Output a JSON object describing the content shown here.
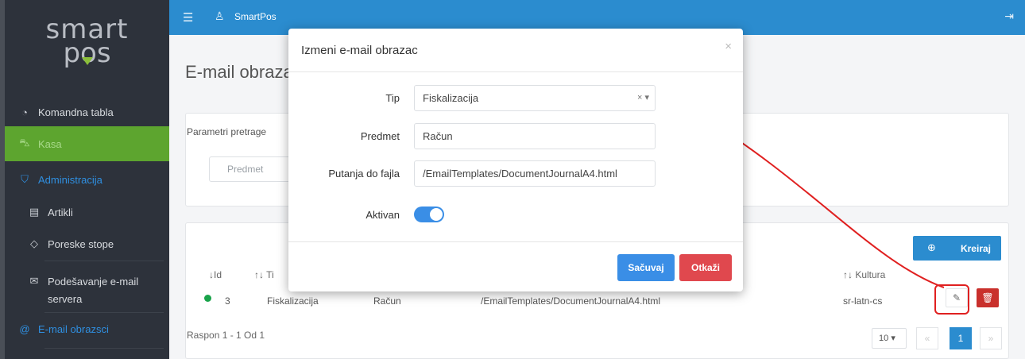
{
  "sidebar": {
    "logo_line1": "smart",
    "logo_line2": "pos",
    "items": [
      {
        "label": "Komandna tabla",
        "icon": "dashboard-icon"
      },
      {
        "label": "Kasa",
        "icon": "cart-icon"
      },
      {
        "label": "Administracija",
        "icon": "shield-icon"
      },
      {
        "label": "Artikli",
        "icon": "book-icon"
      },
      {
        "label": "Poreske stope",
        "icon": "tag-icon"
      },
      {
        "label": "Podešavanje e-mail",
        "label2": "servera",
        "icon": "envelope-icon"
      },
      {
        "label": "E-mail obrazsci",
        "icon": "at-icon"
      }
    ]
  },
  "topbar": {
    "app_name": "SmartPos",
    "menu_icon": "hamburger-icon",
    "user_icon": "user-icon",
    "logout_icon": "logout-icon"
  },
  "main": {
    "page_title": "E-mail obraza",
    "search_panel": {
      "title": "Parametri pretrage",
      "subject_placeholder": "Predmet"
    },
    "create_label": "Kreiraj",
    "table": {
      "headers": [
        "↓Id",
        "↑↓ Ti",
        "↑↓ Kultura"
      ],
      "row": {
        "id": "3",
        "type": "Fiskalizacija",
        "subject": "Račun",
        "path": "/EmailTemplates/DocumentJournalA4.html",
        "culture": "sr-latn-cs"
      }
    },
    "range_text": "Raspon 1 - 1 Od 1",
    "page_size": "10",
    "pagination": {
      "prev": "«",
      "current": "1",
      "next": "»"
    }
  },
  "modal": {
    "title": "Izmeni e-mail obrazac",
    "close": "×",
    "fields": {
      "tip_label": "Tip",
      "tip_value": "Fiskalizacija",
      "tip_clear": "× ▾",
      "predmet_label": "Predmet",
      "predmet_value": "Račun",
      "putanja_label": "Putanja do fajla",
      "putanja_value": "/EmailTemplates/DocumentJournalA4.html",
      "aktivan_label": "Aktivan"
    },
    "aktivan": true,
    "save_label": "Sačuvaj",
    "cancel_label": "Otkaži"
  },
  "colors": {
    "topbar": "#2b8ccf",
    "sidebar": "#2d323b",
    "active_nav": "#5da52f",
    "save": "#3a8ee6",
    "cancel": "#e0484e",
    "annotation": "#e02020"
  }
}
